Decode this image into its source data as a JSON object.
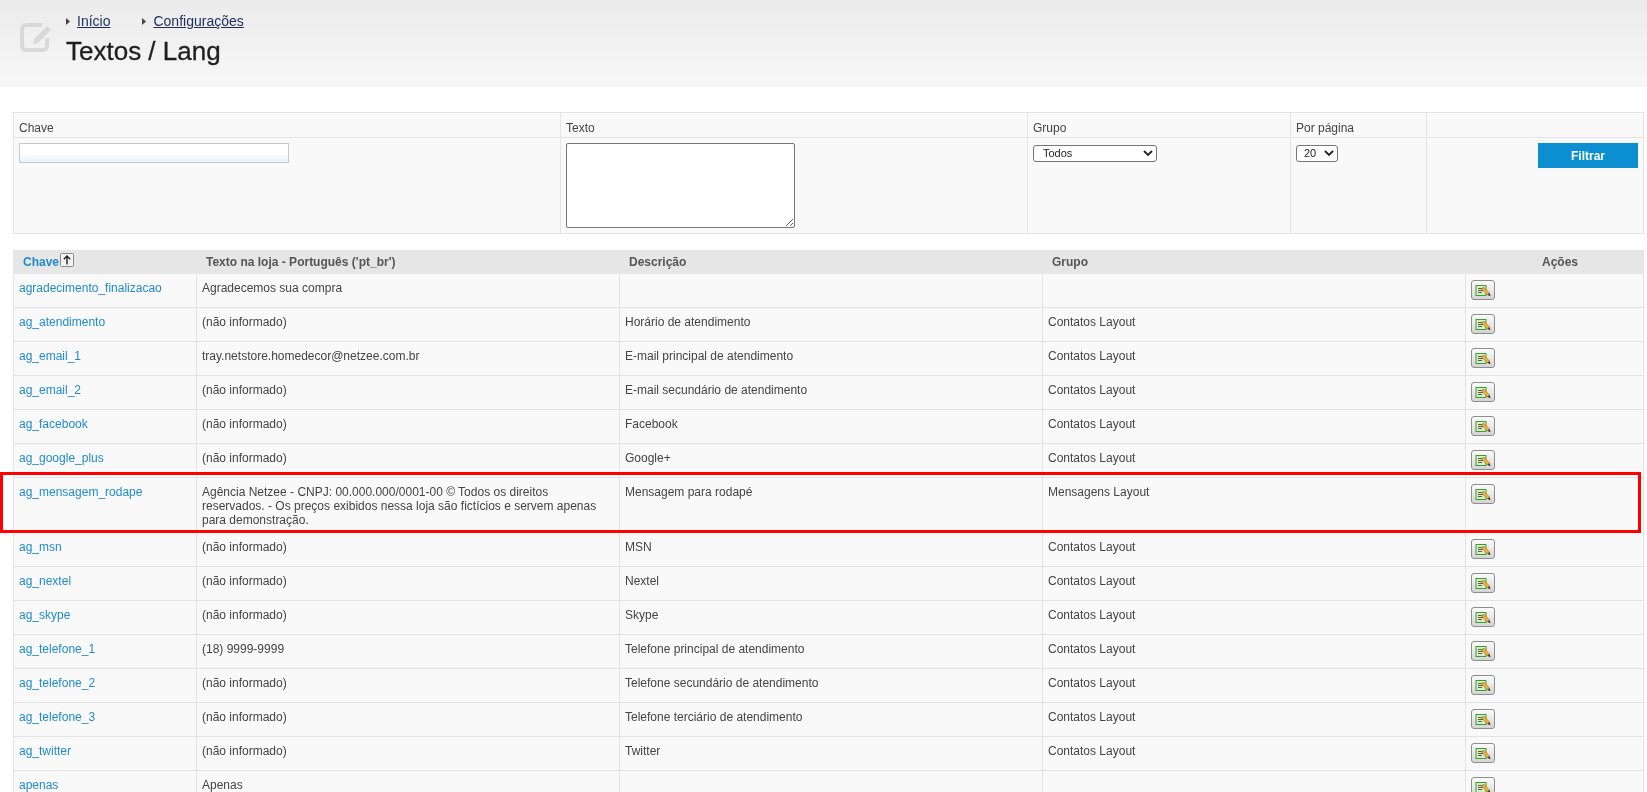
{
  "breadcrumb": [
    {
      "label": "Início"
    },
    {
      "label": "Configurações"
    }
  ],
  "page_title": "Textos / Lang",
  "filters": [
    {
      "kind": "input",
      "label": "Chave"
    },
    {
      "kind": "textarea",
      "label": "Texto"
    },
    {
      "kind": "select",
      "label": "Grupo",
      "value": "Todos"
    },
    {
      "kind": "select",
      "label": "Por página",
      "value": "20"
    },
    {
      "kind": "button",
      "button": "Filtrar"
    }
  ],
  "table": {
    "columns": [
      {
        "label": "Chave",
        "sorted": true
      },
      {
        "label": "Texto na loja - Português ('pt_br')",
        "sorted": false
      },
      {
        "label": "Descrição",
        "sorted": false
      },
      {
        "label": "Grupo",
        "sorted": false
      },
      {
        "label": "Ações",
        "sorted": false
      }
    ],
    "rows": [
      {
        "key": "agradecimento_finalizacao",
        "text": "Agradecemos sua compra",
        "highlighted": false
      },
      {
        "key": "ag_atendimento",
        "text": "(não informado)",
        "description": "Horário de atendimento",
        "group": "Contatos Layout",
        "highlighted": false
      },
      {
        "key": "ag_email_1",
        "text": "tray.netstore.homedecor@netzee.com.br",
        "description": "E-mail principal de atendimento",
        "group": "Contatos Layout",
        "highlighted": false
      },
      {
        "key": "ag_email_2",
        "text": "(não informado)",
        "description": "E-mail secundário de atendimento",
        "group": "Contatos Layout",
        "highlighted": false
      },
      {
        "key": "ag_facebook",
        "text": "(não informado)",
        "description": "Facebook",
        "group": "Contatos Layout",
        "highlighted": false
      },
      {
        "key": "ag_google_plus",
        "text": "(não informado)",
        "description": "Google+",
        "group": "Contatos Layout",
        "highlighted": false
      },
      {
        "key": "ag_mensagem_rodape",
        "text": "Agência Netzee - CNPJ: 00.000.000/0001-00 © Todos os direitos reservados. - Os preços exibidos nessa loja são fictícios e servem apenas para demonstração.",
        "description": "Mensagem para rodapé",
        "group": "Mensagens Layout",
        "highlighted": true
      },
      {
        "key": "ag_msn",
        "text": "(não informado)",
        "description": "MSN",
        "group": "Contatos Layout",
        "highlighted": false
      },
      {
        "key": "ag_nextel",
        "text": "(não informado)",
        "description": "Nextel",
        "group": "Contatos Layout",
        "highlighted": false
      },
      {
        "key": "ag_skype",
        "text": "(não informado)",
        "description": "Skype",
        "group": "Contatos Layout",
        "highlighted": false
      },
      {
        "key": "ag_telefone_1",
        "text": "(18) 9999-9999",
        "description": "Telefone principal de atendimento",
        "group": "Contatos Layout",
        "highlighted": false
      },
      {
        "key": "ag_telefone_2",
        "text": "(não informado)",
        "description": "Telefone secundário de atendimento",
        "group": "Contatos Layout",
        "highlighted": false
      },
      {
        "key": "ag_telefone_3",
        "text": "(não informado)",
        "description": "Telefone terciário de atendimento",
        "group": "Contatos Layout",
        "highlighted": false
      },
      {
        "key": "ag_twitter",
        "text": "(não informado)",
        "description": "Twitter",
        "group": "Contatos Layout",
        "highlighted": false
      },
      {
        "key": "apenas",
        "text": "Apenas",
        "highlighted": false
      }
    ]
  }
}
